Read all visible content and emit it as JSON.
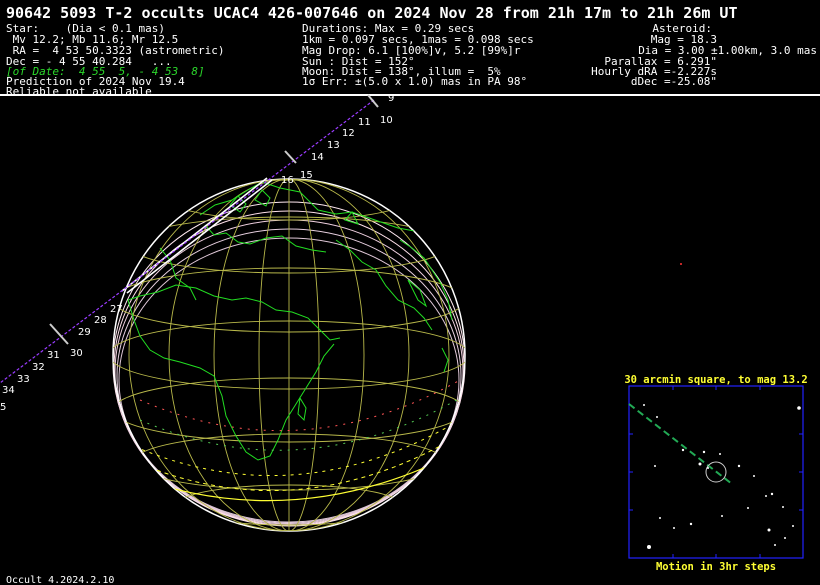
{
  "header": {
    "title": "90642 5093 T-2 occults UCAC4 426-007646 on 2024 Nov 28 from 21h 17m to 21h 26m UT"
  },
  "star": {
    "l1": "Star:    (Dia < 0.1 mas)",
    "l2": " Mv 12.2; Mb 11.6; Mr 12.5",
    "l3": " RA =  4 53 50.3323 (astrometric)",
    "l4": "Dec = - 4 55 40.284   ...",
    "l5": "[of Date:  4 55  5, - 4 53  8]",
    "l6": "Prediction of 2024 Nov 19.4",
    "l7": "Reliable not available"
  },
  "durations": {
    "l1": "Durations: Max = 0.29 secs",
    "l2": "1km = 0.097 secs, 1mas = 0.098 secs",
    "l3": "Mag Drop: 6.1 [100%]v, 5.2 [99%]r",
    "l4": "Sun : Dist = 152°",
    "l5": "Moon: Dist = 138°, illum =  5%",
    "l6": "1σ Err: ±(5.0 x 1.0) mas in PA 98°"
  },
  "asteroid": {
    "l1": "Asteroid:",
    "l2": "Mag = 18.3",
    "l3": "Dia = 3.00 ±1.00km, 3.0 mas",
    "l4": "Parallax = 6.291\"",
    "l5": "Hourly dRA =-2.227s",
    "l6": "dDec =-25.08\""
  },
  "path_ticks": [
    "5",
    "9",
    "10",
    "11",
    "12",
    "13",
    "14",
    "15",
    "16",
    "27",
    "28",
    "29",
    "30",
    "31",
    "32",
    "33",
    "34"
  ],
  "starchart": {
    "title": "30 arcmin square, to mag 13.2",
    "footer": "Motion in 3hr steps"
  },
  "footer": {
    "version": "Occult 4.2024.2.10"
  },
  "colors": {
    "globe_grid": "#b8b84a",
    "coastline": "#22dd22",
    "path": "#9a3cff",
    "chart_frame": "#2222ff",
    "chart_text": "#ffff33"
  }
}
